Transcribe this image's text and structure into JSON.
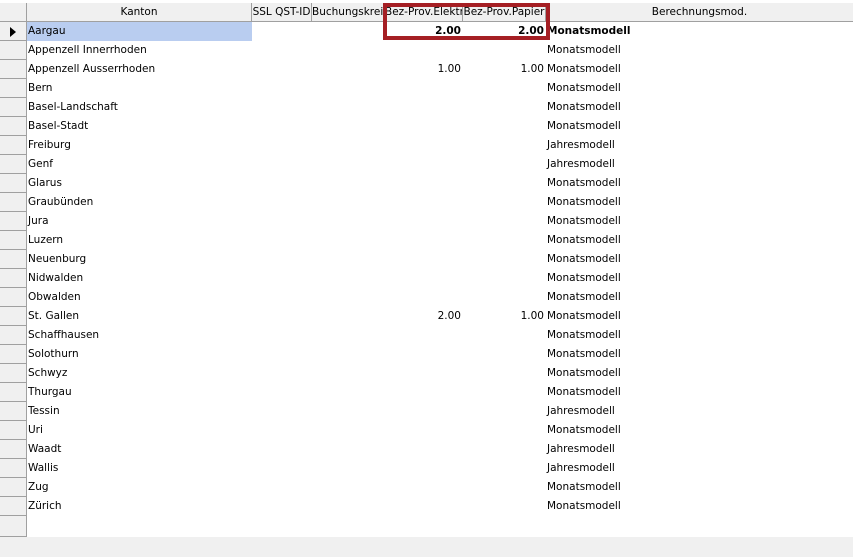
{
  "columns": {
    "kanton": "Kanton",
    "ssl": "SSL QST-ID",
    "buchung": "Buchungskreis",
    "elektr": "Bez-Prov.Elektr",
    "papier": "Bez-Prov.Papier",
    "modell": "Berechnungsmod."
  },
  "rows": [
    {
      "kanton": "Aargau",
      "elektr": "2.00",
      "papier": "2.00",
      "modell": "Monatsmodell"
    },
    {
      "kanton": "Appenzell Innerrhoden",
      "elektr": "",
      "papier": "",
      "modell": "Monatsmodell"
    },
    {
      "kanton": "Appenzell Ausserrhoden",
      "elektr": "1.00",
      "papier": "1.00",
      "modell": "Monatsmodell"
    },
    {
      "kanton": "Bern",
      "elektr": "",
      "papier": "",
      "modell": "Monatsmodell"
    },
    {
      "kanton": "Basel-Landschaft",
      "elektr": "",
      "papier": "",
      "modell": "Monatsmodell"
    },
    {
      "kanton": "Basel-Stadt",
      "elektr": "",
      "papier": "",
      "modell": "Monatsmodell"
    },
    {
      "kanton": "Freiburg",
      "elektr": "",
      "papier": "",
      "modell": "Jahresmodell"
    },
    {
      "kanton": "Genf",
      "elektr": "",
      "papier": "",
      "modell": "Jahresmodell"
    },
    {
      "kanton": "Glarus",
      "elektr": "",
      "papier": "",
      "modell": "Monatsmodell"
    },
    {
      "kanton": "Graubünden",
      "elektr": "",
      "papier": "",
      "modell": "Monatsmodell"
    },
    {
      "kanton": "Jura",
      "elektr": "",
      "papier": "",
      "modell": "Monatsmodell"
    },
    {
      "kanton": "Luzern",
      "elektr": "",
      "papier": "",
      "modell": "Monatsmodell"
    },
    {
      "kanton": "Neuenburg",
      "elektr": "",
      "papier": "",
      "modell": "Monatsmodell"
    },
    {
      "kanton": "Nidwalden",
      "elektr": "",
      "papier": "",
      "modell": "Monatsmodell"
    },
    {
      "kanton": "Obwalden",
      "elektr": "",
      "papier": "",
      "modell": "Monatsmodell"
    },
    {
      "kanton": "St. Gallen",
      "elektr": "2.00",
      "papier": "1.00",
      "modell": "Monatsmodell"
    },
    {
      "kanton": "Schaffhausen",
      "elektr": "",
      "papier": "",
      "modell": "Monatsmodell"
    },
    {
      "kanton": "Solothurn",
      "elektr": "",
      "papier": "",
      "modell": "Monatsmodell"
    },
    {
      "kanton": "Schwyz",
      "elektr": "",
      "papier": "",
      "modell": "Monatsmodell"
    },
    {
      "kanton": "Thurgau",
      "elektr": "",
      "papier": "",
      "modell": "Monatsmodell"
    },
    {
      "kanton": "Tessin",
      "elektr": "",
      "papier": "",
      "modell": "Jahresmodell"
    },
    {
      "kanton": "Uri",
      "elektr": "",
      "papier": "",
      "modell": "Monatsmodell"
    },
    {
      "kanton": "Waadt",
      "elektr": "",
      "papier": "",
      "modell": "Jahresmodell"
    },
    {
      "kanton": "Wallis",
      "elektr": "",
      "papier": "",
      "modell": "Jahresmodell"
    },
    {
      "kanton": "Zug",
      "elektr": "",
      "papier": "",
      "modell": "Monatsmodell"
    },
    {
      "kanton": "Zürich",
      "elektr": "",
      "papier": "",
      "modell": "Monatsmodell"
    }
  ],
  "colors": {
    "highlight_box": "#a51f24",
    "selected_cell": "#b9cdf0"
  }
}
